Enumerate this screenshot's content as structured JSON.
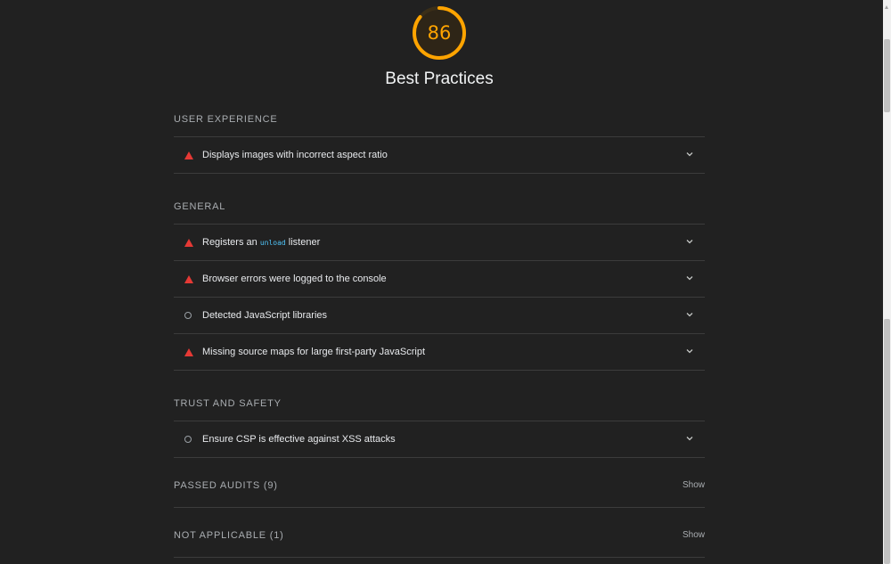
{
  "header": {
    "score": "86",
    "score_fraction": 0.86,
    "score_color": "#ffa400",
    "title": "Best Practices"
  },
  "groups": [
    {
      "title": "USER EXPERIENCE",
      "audits": [
        {
          "icon": "warning-triangle-icon",
          "text": "Displays images with incorrect aspect ratio"
        }
      ]
    },
    {
      "title": "GENERAL",
      "audits": [
        {
          "icon": "warning-triangle-icon",
          "text_before": "Registers an ",
          "code": "unload",
          "text_after": " listener"
        },
        {
          "icon": "warning-triangle-icon",
          "text": "Browser errors were logged to the console"
        },
        {
          "icon": "informative-circle-icon",
          "text": "Detected JavaScript libraries"
        },
        {
          "icon": "warning-triangle-icon",
          "text": "Missing source maps for large first-party JavaScript"
        }
      ]
    },
    {
      "title": "TRUST AND SAFETY",
      "audits": [
        {
          "icon": "informative-circle-icon",
          "text": "Ensure CSP is effective against XSS attacks"
        }
      ]
    }
  ],
  "passed": {
    "label": "PASSED AUDITS (9)",
    "action": "Show"
  },
  "not_applicable": {
    "label": "NOT APPLICABLE (1)",
    "action": "Show"
  },
  "colors": {
    "background": "#212121",
    "fail": "#e53935",
    "average": "#ffa400",
    "code": "#4fc3f7"
  }
}
